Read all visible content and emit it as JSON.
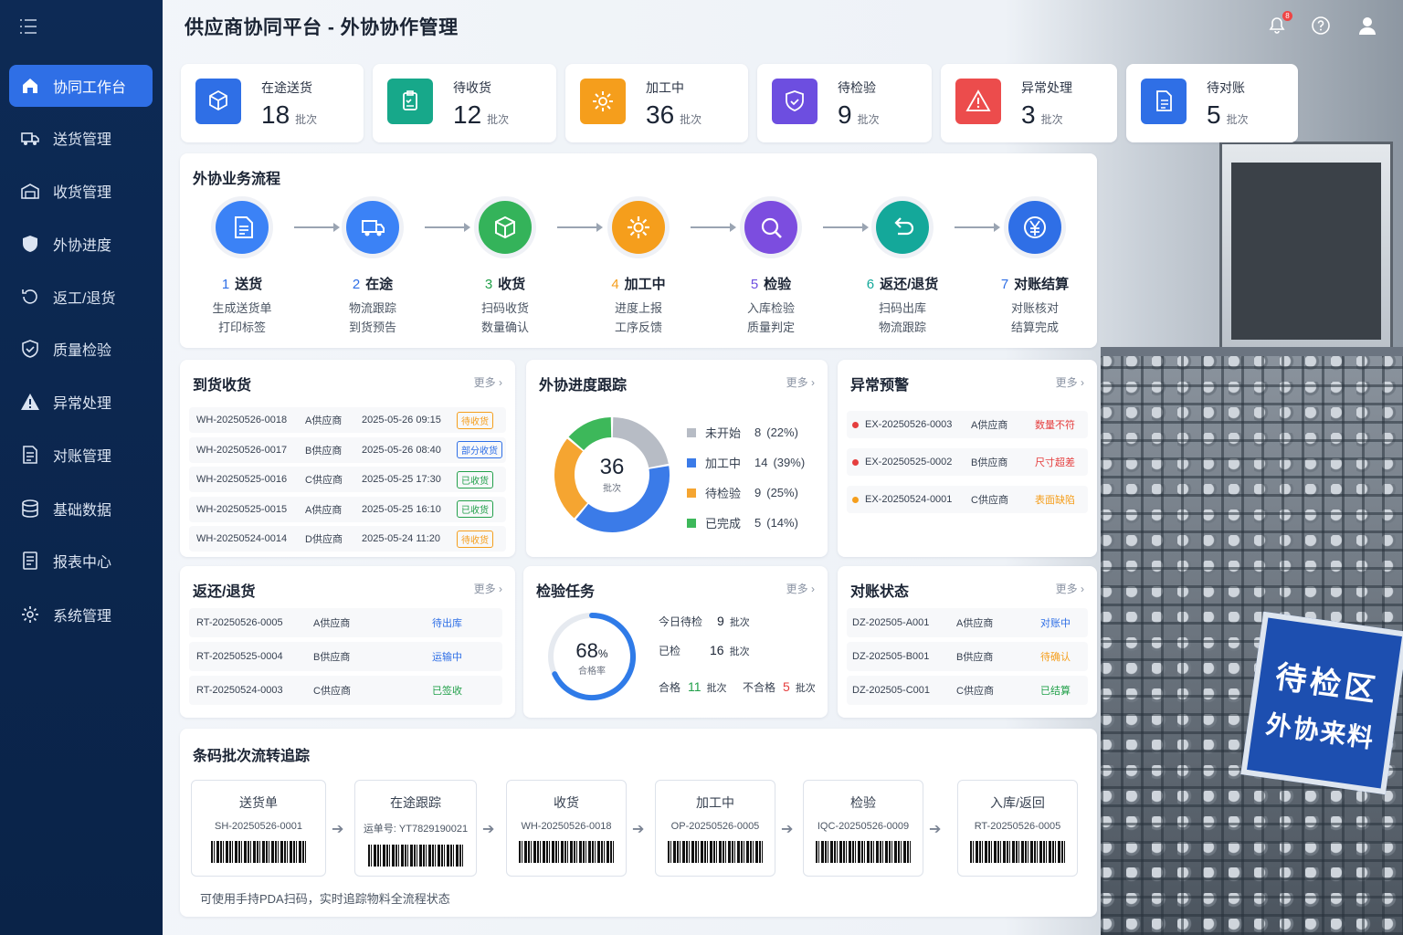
{
  "app_title": "供应商协同平台 - 外协协作管理",
  "notification_count": "8",
  "sidebar": {
    "items": [
      {
        "label": "协同工作台",
        "icon": "home-icon",
        "active": true
      },
      {
        "label": "送货管理",
        "icon": "truck-icon"
      },
      {
        "label": "收货管理",
        "icon": "warehouse-icon"
      },
      {
        "label": "外协进度",
        "icon": "shield-icon"
      },
      {
        "label": "返工/退货",
        "icon": "return-icon"
      },
      {
        "label": "质量检验",
        "icon": "check-shield-icon"
      },
      {
        "label": "异常处理",
        "icon": "warning-icon"
      },
      {
        "label": "对账管理",
        "icon": "invoice-icon"
      },
      {
        "label": "基础数据",
        "icon": "database-icon"
      },
      {
        "label": "报表中心",
        "icon": "report-icon"
      },
      {
        "label": "系统管理",
        "icon": "gear-icon"
      }
    ]
  },
  "stats": [
    {
      "label": "在途送货",
      "value": "18",
      "unit": "批次",
      "color": "#2f6fe6"
    },
    {
      "label": "待收货",
      "value": "12",
      "unit": "批次",
      "color": "#17a88a"
    },
    {
      "label": "加工中",
      "value": "36",
      "unit": "批次",
      "color": "#f59e1c"
    },
    {
      "label": "待检验",
      "value": "9",
      "unit": "批次",
      "color": "#6d4ee0"
    },
    {
      "label": "异常处理",
      "value": "3",
      "unit": "批次",
      "color": "#ec4c4c"
    },
    {
      "label": "待对账",
      "value": "5",
      "unit": "批次",
      "color": "#2f6fe6"
    }
  ],
  "flow": {
    "title": "外协业务流程",
    "steps": [
      {
        "num": "1",
        "name": "送货",
        "d1": "生成送货单",
        "d2": "打印标签",
        "color": "#3b82f6",
        "numcolor": "#2f6fe6"
      },
      {
        "num": "2",
        "name": "在途",
        "d1": "物流跟踪",
        "d2": "到货预告",
        "color": "#3b82f6",
        "numcolor": "#2f6fe6"
      },
      {
        "num": "3",
        "name": "收货",
        "d1": "扫码收货",
        "d2": "数量确认",
        "color": "#34b35a",
        "numcolor": "#22a04a"
      },
      {
        "num": "4",
        "name": "加工中",
        "d1": "进度上报",
        "d2": "工序反馈",
        "color": "#f59e1c",
        "numcolor": "#f59e1c"
      },
      {
        "num": "5",
        "name": "检验",
        "d1": "入库检验",
        "d2": "质量判定",
        "color": "#7c4ddf",
        "numcolor": "#6d4ee0"
      },
      {
        "num": "6",
        "name": "返还/退货",
        "d1": "扫码出库",
        "d2": "物流跟踪",
        "color": "#14a89a",
        "numcolor": "#14a89a"
      },
      {
        "num": "7",
        "name": "对账结算",
        "d1": "对账核对",
        "d2": "结算完成",
        "color": "#2f6fe6",
        "numcolor": "#2f6fe6"
      }
    ]
  },
  "more_label": "更多",
  "arrivals": {
    "title": "到货收货",
    "rows": [
      {
        "id": "WH-20250526-0018",
        "supplier": "A供应商",
        "time": "2025-05-26 09:15",
        "status": "待收货",
        "color": "#f59e1c"
      },
      {
        "id": "WH-20250526-0017",
        "supplier": "B供应商",
        "time": "2025-05-26 08:40",
        "status": "部分收货",
        "color": "#2f6fe6"
      },
      {
        "id": "WH-20250525-0016",
        "supplier": "C供应商",
        "time": "2025-05-25 17:30",
        "status": "已收货",
        "color": "#22a04a"
      },
      {
        "id": "WH-20250525-0015",
        "supplier": "A供应商",
        "time": "2025-05-25 16:10",
        "status": "已收货",
        "color": "#22a04a"
      },
      {
        "id": "WH-20250524-0014",
        "supplier": "D供应商",
        "time": "2025-05-24 11:20",
        "status": "待收货",
        "color": "#f59e1c"
      }
    ]
  },
  "progress": {
    "title": "外协进度跟踪",
    "total": "36",
    "total_unit": "批次",
    "legend": [
      {
        "name": "未开始",
        "count": "8",
        "pct": "(22%)",
        "color": "#b7bcc5"
      },
      {
        "name": "加工中",
        "count": "14",
        "pct": "(39%)",
        "color": "#3b7be8"
      },
      {
        "name": "待检验",
        "count": "9",
        "pct": "(25%)",
        "color": "#f5a531"
      },
      {
        "name": "已完成",
        "count": "5",
        "pct": "(14%)",
        "color": "#3db85a"
      }
    ]
  },
  "chart_data": {
    "type": "pie",
    "categories": [
      "未开始",
      "加工中",
      "待检验",
      "已完成"
    ],
    "values": [
      8,
      14,
      9,
      5
    ],
    "title": "外协进度跟踪"
  },
  "alerts": {
    "title": "异常预警",
    "rows": [
      {
        "id": "EX-20250526-0003",
        "supplier": "A供应商",
        "issue": "数量不符",
        "color": "#e53e3e"
      },
      {
        "id": "EX-20250525-0002",
        "supplier": "B供应商",
        "issue": "尺寸超差",
        "color": "#e53e3e"
      },
      {
        "id": "EX-20250524-0001",
        "supplier": "C供应商",
        "issue": "表面缺陷",
        "color": "#f59e1c"
      }
    ]
  },
  "returns": {
    "title": "返还/退货",
    "rows": [
      {
        "id": "RT-20250526-0005",
        "supplier": "A供应商",
        "status": "待出库",
        "color": "#2f6fe6"
      },
      {
        "id": "RT-20250525-0004",
        "supplier": "B供应商",
        "status": "运输中",
        "color": "#2f6fe6"
      },
      {
        "id": "RT-20250524-0003",
        "supplier": "C供应商",
        "status": "已签收",
        "color": "#22a04a"
      }
    ]
  },
  "inspection": {
    "title": "检验任务",
    "rate": "68",
    "rate_sign": "%",
    "rate_fraction": 0.68,
    "rate_label": "合格率",
    "today_label": "今日待检",
    "today_value": "9",
    "done_label": "已检",
    "done_value": "16",
    "pass_label": "合格",
    "pass_value": "11",
    "fail_label": "不合格",
    "fail_value": "5",
    "unit": "批次"
  },
  "reconcile": {
    "title": "对账状态",
    "rows": [
      {
        "id": "DZ-202505-A001",
        "supplier": "A供应商",
        "status": "对账中",
        "color": "#2f6fe6"
      },
      {
        "id": "DZ-202505-B001",
        "supplier": "B供应商",
        "status": "待确认",
        "color": "#f59e1c"
      },
      {
        "id": "DZ-202505-C001",
        "supplier": "C供应商",
        "status": "已结算",
        "color": "#22a04a"
      }
    ]
  },
  "barcode": {
    "title": "条码批次流转追踪",
    "cards": [
      {
        "h": "送货单",
        "code": "SH-20250526-0001"
      },
      {
        "h": "在途跟踪",
        "code": "运单号: YT7829190021"
      },
      {
        "h": "收货",
        "code": "WH-20250526-0018"
      },
      {
        "h": "加工中",
        "code": "OP-20250526-0005"
      },
      {
        "h": "检验",
        "code": "IQC-20250526-0009"
      },
      {
        "h": "入库/返回",
        "code": "RT-20250526-0005"
      }
    ],
    "footer": "可使用手持PDA扫码，实时追踪物料全流程状态"
  },
  "sign": {
    "line1": "待检区",
    "line2": "外协来料"
  }
}
